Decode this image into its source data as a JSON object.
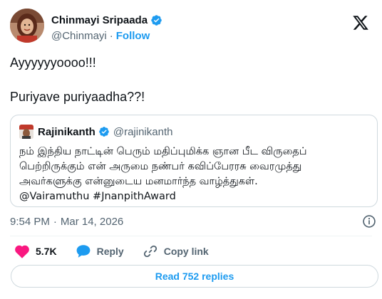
{
  "author": {
    "name": "Chinmayi Sripaada",
    "handle": "@Chinmayi",
    "separator": "·",
    "follow_label": "Follow",
    "verified": true
  },
  "tweet": {
    "lines": [
      "Ayyyyyyoooo!!!",
      "Puriyave puriyaadha??!"
    ]
  },
  "quoted_tweet": {
    "name": "Rajinikanth",
    "handle": "@rajinikanth",
    "verified": true,
    "lines": [
      "நம் இந்திய நாட்டின் பெரும் மதிப்புமிக்க ஞான பீட விருதைப்",
      "பெற்றிருக்கும் என் அருமை நண்பர் கவிப்பேரரசு வைரமுத்து",
      "அவர்களுக்கு என்னுடைய மனமார்ந்த வாழ்த்துகள்.",
      "@Vairamuthu #JnanpithAward"
    ]
  },
  "meta": {
    "time": "9:54 PM",
    "separator": "·",
    "date": "Mar 14, 2026"
  },
  "actions": {
    "like_count": "5.7K",
    "reply_label": "Reply",
    "copy_link_label": "Copy link"
  },
  "read_replies_label": "Read 752 replies",
  "colors": {
    "accent": "#1d9bf0",
    "like": "#f91880",
    "text": "#0f1419",
    "muted": "#536471",
    "border": "#cfd9de"
  },
  "icons": [
    "verified-badge-icon",
    "x-logo-icon",
    "info-icon",
    "heart-icon",
    "reply-bubble-icon",
    "link-icon"
  ]
}
